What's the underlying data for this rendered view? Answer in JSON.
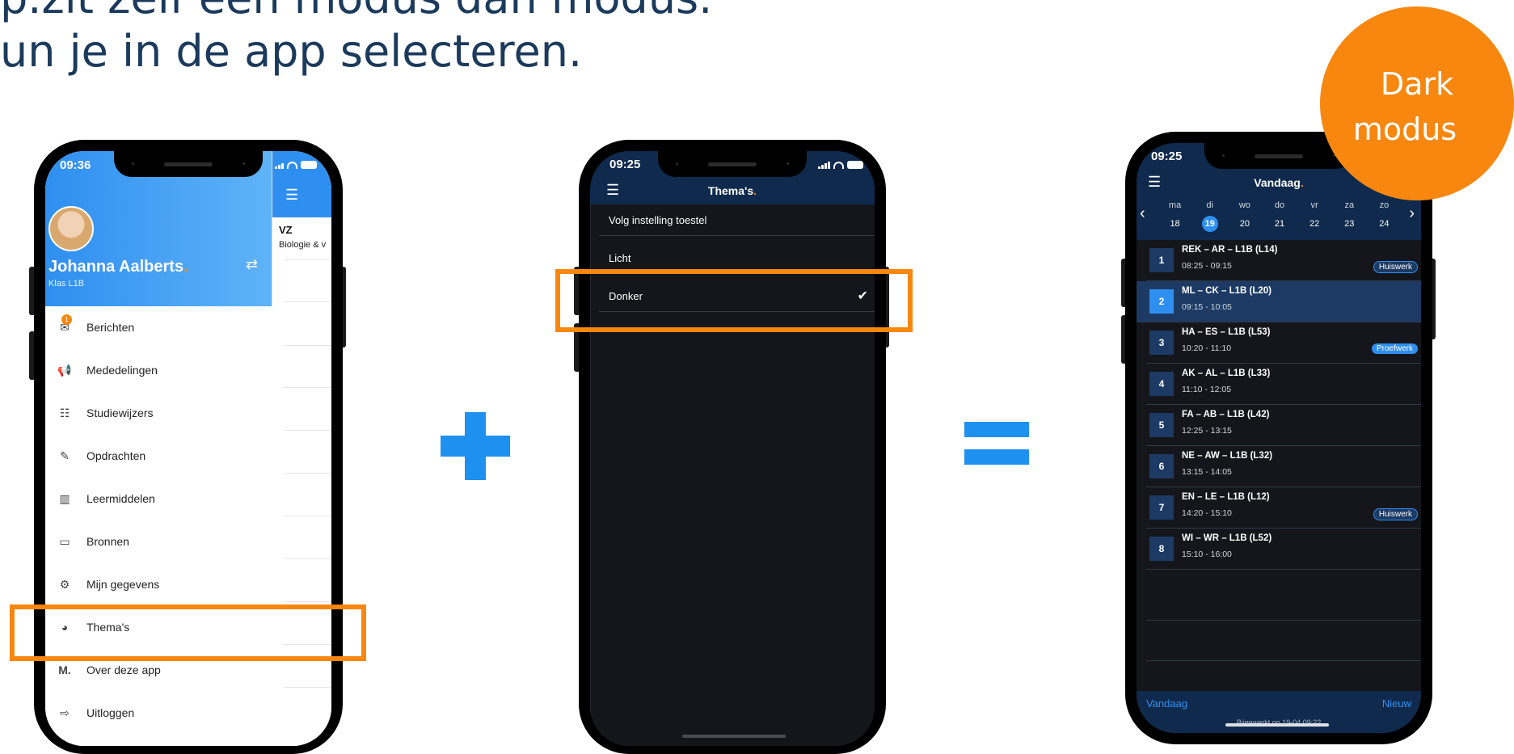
{
  "headline": {
    "line1": "p.zit zelf een modus dan modus.",
    "line2": "un je in de app selecteren."
  },
  "badge": {
    "line1": "Dark",
    "line2": "modus"
  },
  "colors": {
    "accent": "#f7870f",
    "blue": "#2f8ff0",
    "dark_bg": "#15161b",
    "navy": "#0f2a4d"
  },
  "phone1": {
    "time": "09:36",
    "user_name": "Johanna  Aalberts",
    "user_dot": ".",
    "class": "Klas L1B",
    "right_heading": "VZ",
    "right_sub": "Biologie & v",
    "unread_count": "1",
    "menu": [
      {
        "label": "Berichten",
        "icon": "envelope-icon"
      },
      {
        "label": "Mededelingen",
        "icon": "megaphone-icon"
      },
      {
        "label": "Studiewijzers",
        "icon": "signpost-icon"
      },
      {
        "label": "Opdrachten",
        "icon": "pencil-icon"
      },
      {
        "label": "Leermiddelen",
        "icon": "books-icon"
      },
      {
        "label": "Bronnen",
        "icon": "folder-icon"
      },
      {
        "label": "Mijn gegevens",
        "icon": "gear-icon"
      },
      {
        "label": "Thema's",
        "icon": "palette-icon"
      },
      {
        "label": "Over deze app",
        "icon": "m-logo-icon"
      },
      {
        "label": "Uitloggen",
        "icon": "logout-icon"
      }
    ]
  },
  "plus_sign": "+",
  "equals_sign": "=",
  "phone2": {
    "time": "09:25",
    "title": "Thema's",
    "title_dot": ".",
    "options": [
      {
        "label": "Volg instelling toestel",
        "selected": false
      },
      {
        "label": "Licht",
        "selected": false
      },
      {
        "label": "Donker",
        "selected": true
      }
    ],
    "check": "✔"
  },
  "phone3": {
    "time": "09:25",
    "title": "Vandaag",
    "title_dot": ".",
    "days": [
      {
        "name": "ma",
        "date": "18"
      },
      {
        "name": "di",
        "date": "19"
      },
      {
        "name": "wo",
        "date": "20"
      },
      {
        "name": "do",
        "date": "21"
      },
      {
        "name": "vr",
        "date": "22"
      },
      {
        "name": "za",
        "date": "23"
      },
      {
        "name": "zo",
        "date": "24"
      }
    ],
    "selected_day": "19",
    "lessons": [
      {
        "num": "1",
        "title": "REK – AR – L1B (L14)",
        "time": "08:25 - 09:15",
        "tag": "Huiswerk"
      },
      {
        "num": "2",
        "title": "ML – CK – L1B (L20)",
        "time": "09:15 - 10:05",
        "tag": ""
      },
      {
        "num": "3",
        "title": "HA – ES – L1B (L53)",
        "time": "10:20 - 11:10",
        "tag": "Proefwerk"
      },
      {
        "num": "4",
        "title": "AK – AL – L1B (L33)",
        "time": "11:10 - 12:05",
        "tag": ""
      },
      {
        "num": "5",
        "title": "FA – AB – L1B (L42)",
        "time": "12:25 - 13:15",
        "tag": ""
      },
      {
        "num": "6",
        "title": "NE – AW – L1B (L32)",
        "time": "13:15 - 14:05",
        "tag": ""
      },
      {
        "num": "7",
        "title": "EN – LE – L1B (L12)",
        "time": "14:20 - 15:10",
        "tag": "Huiswerk"
      },
      {
        "num": "8",
        "title": "WI – WR – L1B (L52)",
        "time": "15:10 - 16:00",
        "tag": ""
      }
    ],
    "footer_left": "Vandaag",
    "footer_right": "Nieuw",
    "updated": "Bijgewerkt op 19-04 09:22"
  }
}
